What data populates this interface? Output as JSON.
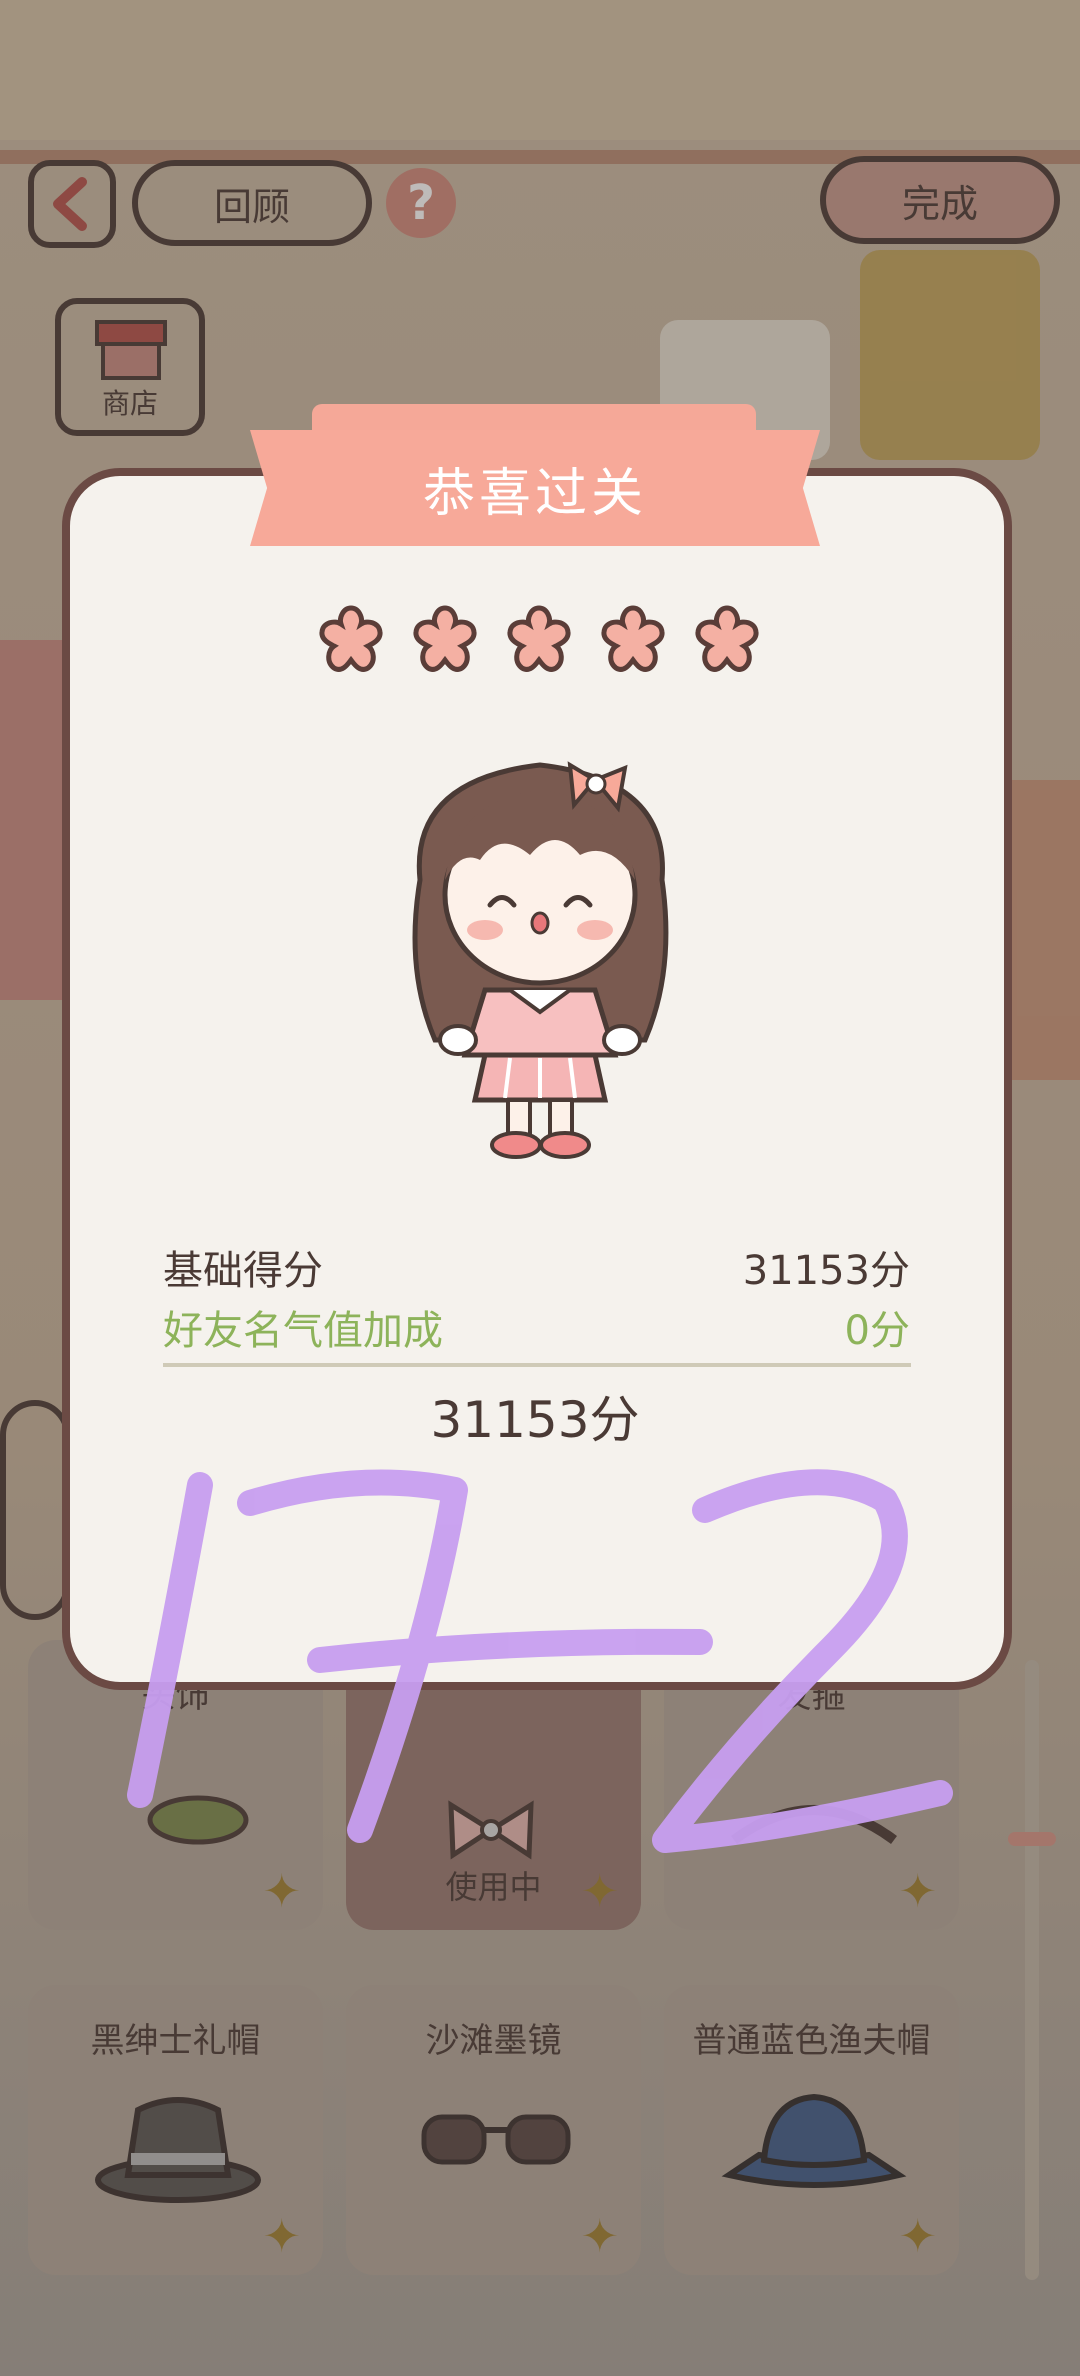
{
  "header": {
    "review_label": "回顾",
    "done_label": "完成",
    "shop_label": "商店"
  },
  "dialog": {
    "title": "恭喜过关",
    "stars": 5,
    "base_score_label": "基础得分",
    "base_score_value": "31153分",
    "bonus_label": "好友名气值加成",
    "bonus_value": "0分",
    "total": "31153分"
  },
  "items": [
    {
      "name": "头饰",
      "status": ""
    },
    {
      "name": "",
      "status": "使用中"
    },
    {
      "name": "发箍",
      "status": ""
    },
    {
      "name": "黑绅士礼帽",
      "status": ""
    },
    {
      "name": "沙滩墨镜",
      "status": ""
    },
    {
      "name": "普通蓝色渔夫帽",
      "status": ""
    }
  ],
  "annotation": {
    "handwriting": "17-2",
    "color": "#c79ef0"
  },
  "colors": {
    "accent": "#f7a999",
    "outline": "#4a3a35",
    "green": "#8db35a",
    "panel": "#f5f2ed"
  }
}
